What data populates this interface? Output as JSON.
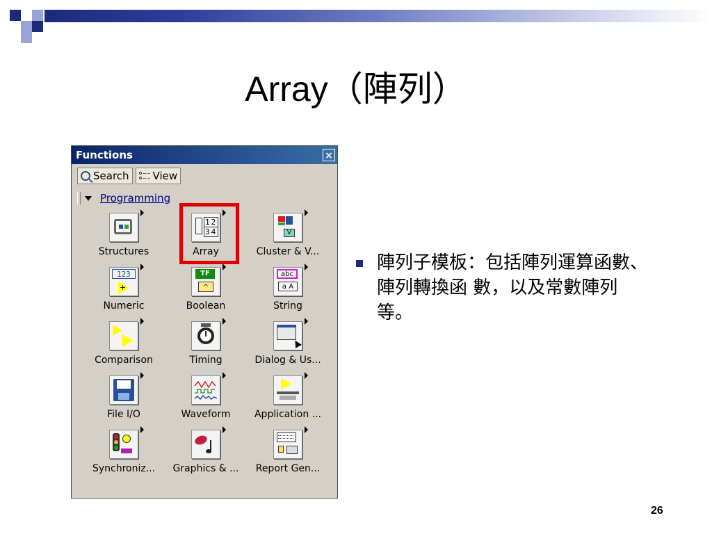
{
  "slide": {
    "title": "Array（陣列）",
    "page_number": "26"
  },
  "palette": {
    "title": "Functions",
    "close_glyph": "×",
    "search_label": "Search",
    "view_label": "View",
    "category": "Programming",
    "items": [
      {
        "label": "Structures",
        "icon": "structures-icon"
      },
      {
        "label": "Array",
        "icon": "array-icon"
      },
      {
        "label": "Cluster & V...",
        "icon": "cluster-icon"
      },
      {
        "label": "Numeric",
        "icon": "numeric-icon"
      },
      {
        "label": "Boolean",
        "icon": "boolean-icon"
      },
      {
        "label": "String",
        "icon": "string-icon"
      },
      {
        "label": "Comparison",
        "icon": "comparison-icon"
      },
      {
        "label": "Timing",
        "icon": "timing-icon"
      },
      {
        "label": "Dialog & Us...",
        "icon": "dialog-icon"
      },
      {
        "label": "File I/O",
        "icon": "file-io-icon"
      },
      {
        "label": "Waveform",
        "icon": "waveform-icon"
      },
      {
        "label": "Application ...",
        "icon": "application-icon"
      },
      {
        "label": "Synchroniz...",
        "icon": "synchronization-icon"
      },
      {
        "label": "Graphics & ...",
        "icon": "graphics-icon"
      },
      {
        "label": "Report Gen...",
        "icon": "report-gen-icon"
      }
    ],
    "icon_text": {
      "array_cells": [
        "12",
        "34"
      ],
      "numeric_digits": "123",
      "boolean_tf": "TF",
      "string_abc": "abc"
    },
    "highlight_color": "#e00000"
  },
  "bullet": {
    "text": "陣列子模板：包括陣列運算函數、陣列轉換函 數，以及常數陣列等。"
  },
  "colors": {
    "title_bar": "#0a246a",
    "accent": "#1d2a7a"
  }
}
